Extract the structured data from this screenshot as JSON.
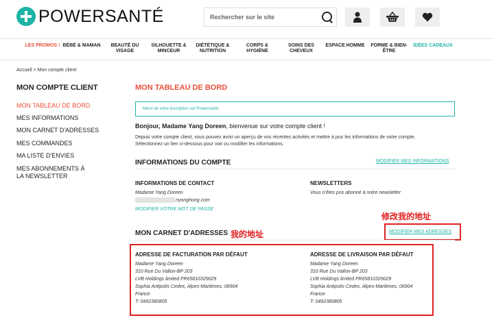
{
  "header": {
    "logo_text": "POWERSANTÉ",
    "search_placeholder": "Rechercher sur le site",
    "icons": [
      "search-icon",
      "user-icon",
      "basket-icon",
      "heart-icon"
    ]
  },
  "nav": [
    {
      "label": "LES PROMOS !",
      "color": "#e8503a"
    },
    {
      "label": "BÉBÉ & MAMAN"
    },
    {
      "label": "BEAUTÉ DU VISAGE"
    },
    {
      "label": "SILHOUETTE & MINCEUR"
    },
    {
      "label": "DIÉTÉTIQUE & NUTRITION"
    },
    {
      "label": "CORPS & HYGIÈNE"
    },
    {
      "label": "SOINS DES CHEVEUX"
    },
    {
      "label": "ESPACE HOMME"
    },
    {
      "label": "FORME & BIEN-ÊTRE"
    },
    {
      "label": "IDÉES CADEAUX",
      "color": "#1db3a6"
    }
  ],
  "breadcrumb": "Accueil > Mon compte client",
  "sidebar": {
    "title": "MON COMPTE CLIENT",
    "items": [
      {
        "label": "MON TABLEAU DE BORD",
        "active": true
      },
      {
        "label": "MES INFORMATIONS"
      },
      {
        "label": "MON CARNET D'ADRESSES"
      },
      {
        "label": "MES COMMANDES"
      },
      {
        "label": "MA LISTE D'ENVIES"
      },
      {
        "label": "MES ABONNEMENTS À LA NEWSLETTER"
      }
    ]
  },
  "main": {
    "title": "MON TABLEAU DE BORD",
    "notice": "Merci de votre inscription sur Powersanté.",
    "greeting_bold": "Bonjour, Madame Yang Doreen",
    "greeting_rest": ", bienvenue sur votre compte client !",
    "intro": "Depuis votre compte client, vous pouvez avoir un aperçu de vos récentes activités et mettre à jour les informations de votre compte. Sélectionnez un lien ci-dessous pour voir ou modifier les informations.",
    "account_info": {
      "title": "INFORMATIONS DU COMPTE",
      "edit_link": "MODIFIER MES INFORMATIONS",
      "contact_title": "INFORMATIONS DE CONTACT",
      "contact_name": "Madame Yang Doreen",
      "contact_email_visible": "nyonghong.com",
      "password_link": "MODIFIER VOTRE MOT DE PASSE",
      "newsletters_title": "NEWSLETTERS",
      "newsletters_text": "Vous n'êtes pos abonné à notre newsletter"
    },
    "address_book": {
      "title": "MON CARNET D'ADRESSES",
      "edit_link": "MODIFIER MES ADRESSES",
      "billing": {
        "title": "ADRESSE DE FACTURATION PAR DÉFAUT",
        "lines": [
          "Madame Yang Doreen",
          "310 Rue Du Vallon-BP 203",
          "LVB Holdings limited FR65810329029",
          "Sophia Antipolis Cedex, Alpes-Maritimes, 06904",
          "France",
          "T: 0492380805"
        ]
      },
      "shipping": {
        "title": "ADRESSE DE LIVRAISON PAR DÉFAUT",
        "lines": [
          "Madame Yang Doreen",
          "310 Rue Du Vallon-BP 203",
          "LVB Holdings limited FR65810329029",
          "Sophia Antipolis Cedex, Alpes-Maritimes, 06904",
          "France",
          "T: 0492380805"
        ]
      }
    }
  },
  "annotations": {
    "edit_address_note": "修改我的地址",
    "my_address_note": "我的地址",
    "color": "#e02020"
  },
  "colors": {
    "accent": "#e8503a",
    "teal": "#1db3a6"
  }
}
